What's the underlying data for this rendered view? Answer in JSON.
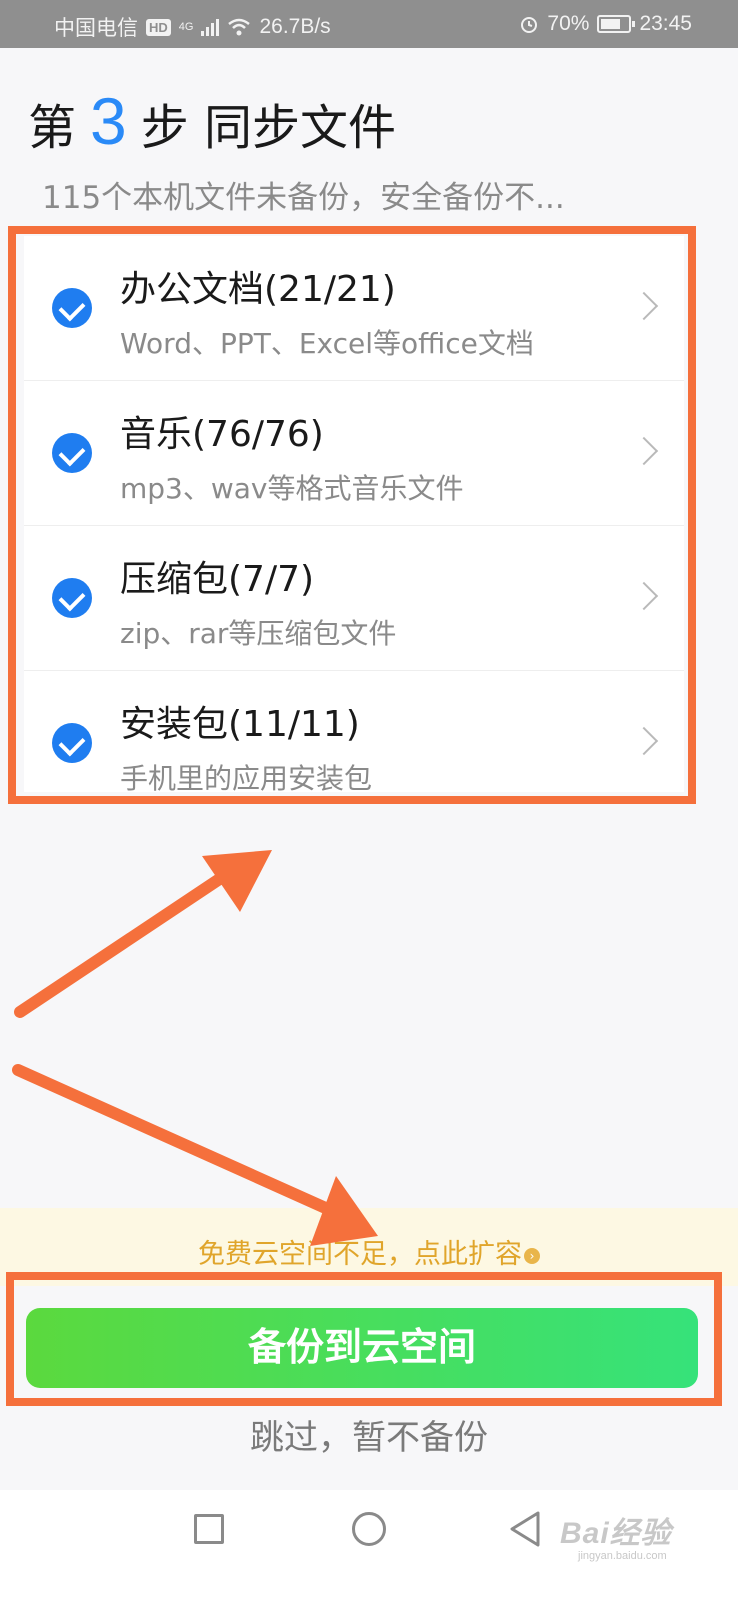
{
  "status_bar": {
    "carrier": "中国电信",
    "hd_badge": "HD",
    "network_type": "4G",
    "speed": "26.7B/s",
    "alarm_icon": "alarm-icon",
    "battery_percent": "70%",
    "battery_level": 0.7,
    "time": "23:45"
  },
  "header": {
    "title_prefix": "第",
    "step_number": "3",
    "title_suffix": "步 同步文件",
    "subtitle": "115个本机文件未备份，安全备份不..."
  },
  "file_categories": [
    {
      "title": "办公文档(21/21)",
      "description": "Word、PPT、Excel等office文档",
      "checked": true,
      "icon": "check-circle-icon"
    },
    {
      "title": "音乐(76/76)",
      "description": "mp3、wav等格式音乐文件",
      "checked": true,
      "icon": "check-circle-icon"
    },
    {
      "title": "压缩包(7/7)",
      "description": "zip、rar等压缩包文件",
      "checked": true,
      "icon": "check-circle-icon"
    },
    {
      "title": "安装包(11/11)",
      "description": "手机里的应用安装包",
      "checked": true,
      "icon": "check-circle-icon"
    }
  ],
  "notice": {
    "text": "免费云空间不足，点此扩容",
    "icon_glyph": "›"
  },
  "actions": {
    "backup_button": "备份到云空间",
    "skip_link": "跳过，暂不备份"
  },
  "nav_bar": {
    "recent_icon": "square-icon",
    "home_icon": "circle-icon",
    "back_icon": "triangle-back-icon"
  },
  "watermark": {
    "main": "Bai经验",
    "sub": "jingyan.baidu.com"
  },
  "colors": {
    "accent_blue": "#2a8af7",
    "annotation_orange": "#f5703c",
    "button_green_start": "#5bd93e",
    "button_green_end": "#36e27a",
    "notice_text": "#e0a52b"
  }
}
